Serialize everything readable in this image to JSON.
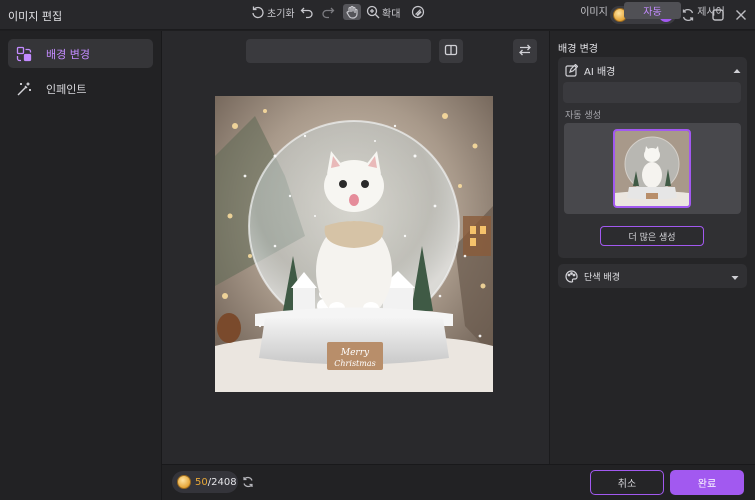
{
  "window": {
    "title": "이미지 편집",
    "credits": "2408",
    "icons": [
      "coin-icon",
      "plus-icon",
      "sync-icon",
      "maximize-icon",
      "close-icon"
    ]
  },
  "sidebar": {
    "items": [
      {
        "label": "배경 변경",
        "icon": "background-change-icon",
        "active": true
      },
      {
        "label": "인페인트",
        "icon": "magic-wand-icon",
        "active": false
      }
    ]
  },
  "toolbar": {
    "reset_label": "초기화",
    "zoom_label": "확대",
    "icons": [
      "reset-icon",
      "undo-icon",
      "redo-icon",
      "hand-icon",
      "zoom-in-icon",
      "eraser-icon",
      "compare-icon",
      "swap-icon"
    ]
  },
  "canvas": {
    "sign_text_line1": "Merry",
    "sign_text_line2": "Christmas"
  },
  "right_panel": {
    "section_title": "배경 변경",
    "ai_background": {
      "label": "AI 배경",
      "tabs": [
        {
          "label": "이미지",
          "active": false
        },
        {
          "label": "자동",
          "active": true
        },
        {
          "label": "제시어",
          "active": false
        }
      ],
      "auto_generate_label": "자동 생성",
      "more_button": "더 많은 생성"
    },
    "solid_background": {
      "label": "단색 배경"
    }
  },
  "footer": {
    "usage_used": "50",
    "usage_total": "/2408",
    "cancel": "취소",
    "done": "완료"
  },
  "colors": {
    "accent": "#a259f0",
    "accent_text": "#c38bff",
    "usage_highlight": "#e8a838"
  }
}
